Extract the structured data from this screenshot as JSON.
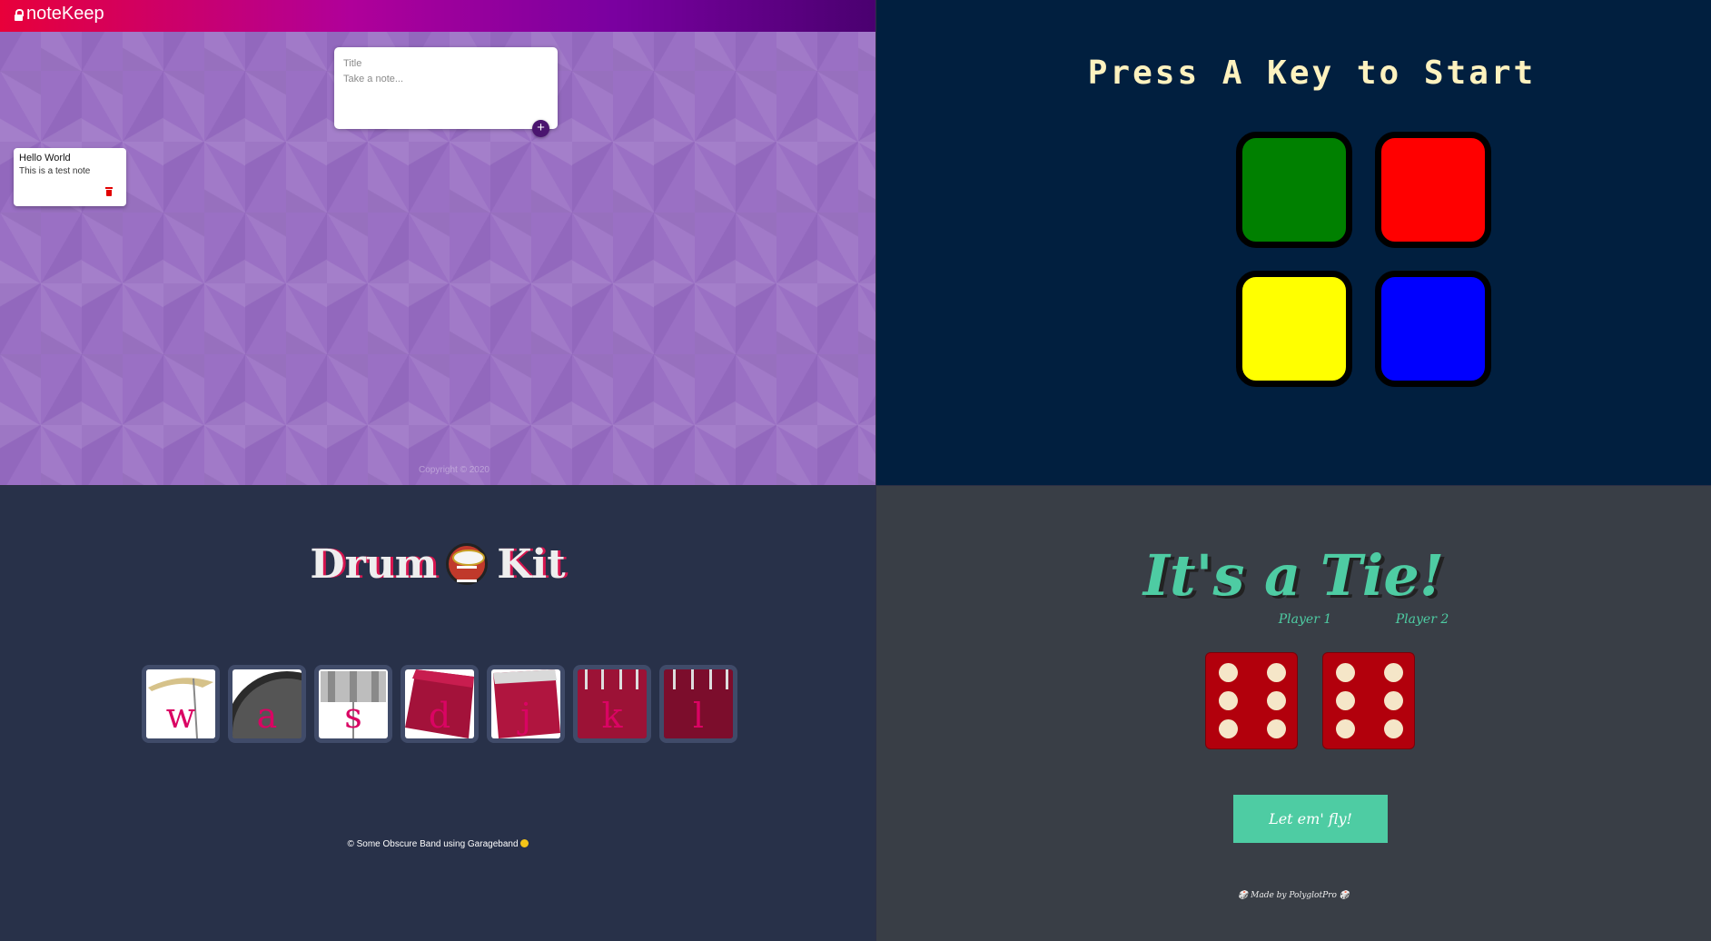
{
  "notekeep": {
    "brand": "noteKeep",
    "title_placeholder": "Title",
    "content_placeholder": "Take a note...",
    "add_symbol": "+",
    "note": {
      "title": "Hello World",
      "content": "This is a test note"
    },
    "footer": "Copyright © 2020",
    "colors": {
      "header_start": "#e8003a",
      "header_end": "#4a0070",
      "accent": "#4a156f",
      "delete": "#e20000"
    }
  },
  "simon": {
    "title": "Press A Key to Start",
    "buttons": [
      {
        "id": "green",
        "color": "#008000"
      },
      {
        "id": "red",
        "color": "#ff0000"
      },
      {
        "id": "yellow",
        "color": "#ffff00"
      },
      {
        "id": "blue",
        "color": "#0000ff"
      }
    ],
    "colors": {
      "background": "#011f3f",
      "title": "#fef2bf"
    }
  },
  "drumkit": {
    "title_left": "Drum",
    "title_right": "Kit",
    "title_icon": "drum-emoji-icon",
    "keys": [
      "w",
      "a",
      "s",
      "d",
      "j",
      "k",
      "l"
    ],
    "footer": "© Some Obscure Band using Garageband",
    "footer_icon": "smile-emoji-icon",
    "colors": {
      "background": "#283149",
      "letter": "#da0463",
      "border": "#404b69"
    }
  },
  "dice": {
    "title": "It's a Tie!",
    "player1": "Player 1",
    "player2": "Player 2",
    "dice_values": [
      6,
      6
    ],
    "button": "Let em' fly!",
    "footer": "🎲 Made by PolyglotPro 🎲",
    "colors": {
      "background": "#393e46",
      "accent": "#4ecca3",
      "die": "#b2000c",
      "pip": "#f5e6c8"
    }
  }
}
